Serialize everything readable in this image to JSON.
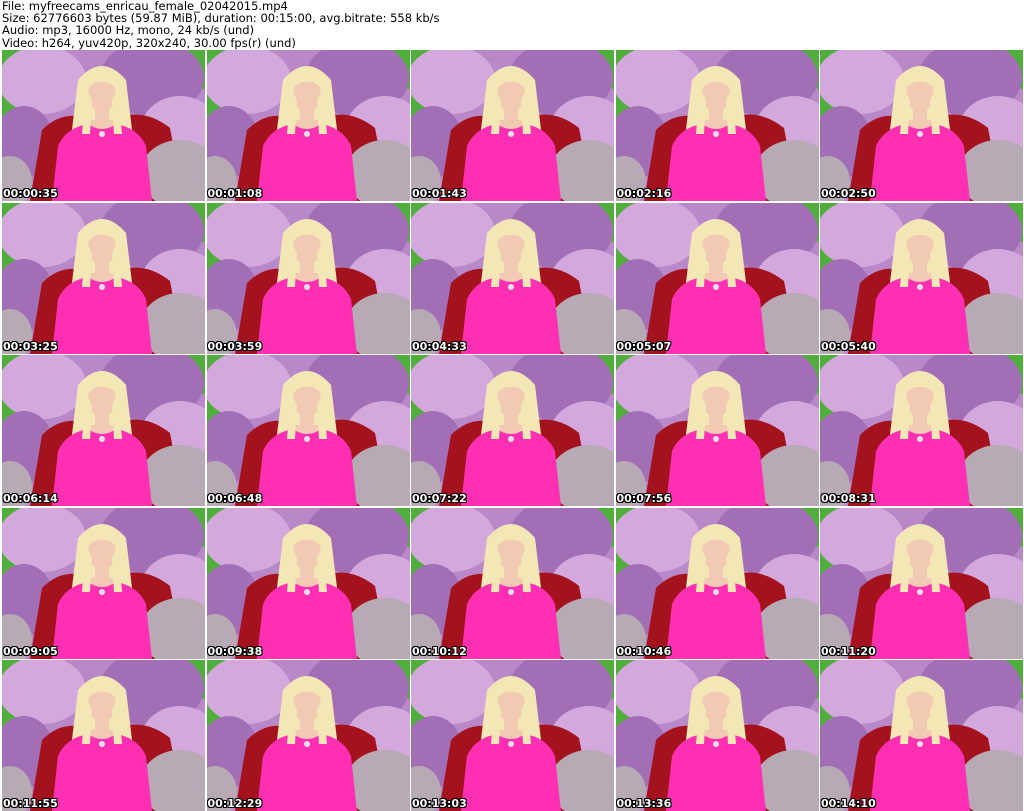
{
  "header": {
    "file_line": "File: myfreecams_enricau_female_02042015.mp4",
    "size_line": "Size: 62776603 bytes (59.87 MiB), duration: 00:15:00, avg.bitrate: 558 kb/s",
    "audio_line": "Audio: mp3, 16000 Hz, mono, 24 kb/s (und)",
    "video_line": "Video: h264, yuv420p, 320x240, 30.00 fps(r) (und)"
  },
  "colors": {
    "background": "#ffffff",
    "text": "#000000",
    "timestamp_text": "#ffffff",
    "timestamp_outline": "#000000",
    "backdrop_purple": "#b988c8",
    "backdrop_green": "#4fae3c",
    "top_pink": "#ff2fb3",
    "couch_red": "#a4121e",
    "pillow_grey": "#b7aab5",
    "hair_blonde": "#f3e7b6",
    "skin": "#f2c9b2"
  },
  "thumbnails": [
    {
      "timestamp": "00:00:35",
      "icon": "video-frame"
    },
    {
      "timestamp": "00:01:08",
      "icon": "video-frame"
    },
    {
      "timestamp": "00:01:43",
      "icon": "video-frame"
    },
    {
      "timestamp": "00:02:16",
      "icon": "video-frame"
    },
    {
      "timestamp": "00:02:50",
      "icon": "video-frame"
    },
    {
      "timestamp": "00:03:25",
      "icon": "video-frame"
    },
    {
      "timestamp": "00:03:59",
      "icon": "video-frame"
    },
    {
      "timestamp": "00:04:33",
      "icon": "video-frame"
    },
    {
      "timestamp": "00:05:07",
      "icon": "video-frame"
    },
    {
      "timestamp": "00:05:40",
      "icon": "video-frame"
    },
    {
      "timestamp": "00:06:14",
      "icon": "video-frame"
    },
    {
      "timestamp": "00:06:48",
      "icon": "video-frame"
    },
    {
      "timestamp": "00:07:22",
      "icon": "video-frame"
    },
    {
      "timestamp": "00:07:56",
      "icon": "video-frame"
    },
    {
      "timestamp": "00:08:31",
      "icon": "video-frame"
    },
    {
      "timestamp": "00:09:05",
      "icon": "video-frame"
    },
    {
      "timestamp": "00:09:38",
      "icon": "video-frame"
    },
    {
      "timestamp": "00:10:12",
      "icon": "video-frame"
    },
    {
      "timestamp": "00:10:46",
      "icon": "video-frame"
    },
    {
      "timestamp": "00:11:20",
      "icon": "video-frame"
    },
    {
      "timestamp": "00:11:55",
      "icon": "video-frame"
    },
    {
      "timestamp": "00:12:29",
      "icon": "video-frame"
    },
    {
      "timestamp": "00:13:03",
      "icon": "video-frame"
    },
    {
      "timestamp": "00:13:36",
      "icon": "video-frame"
    },
    {
      "timestamp": "00:14:10",
      "icon": "video-frame"
    }
  ]
}
